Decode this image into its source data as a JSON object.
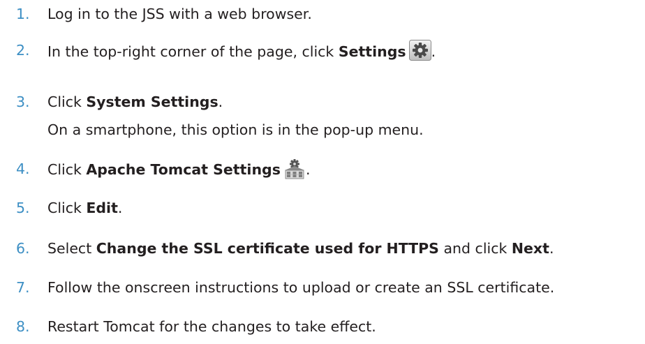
{
  "steps": [
    {
      "number": "1.",
      "text": "Log in to the JSS with a web browser."
    },
    {
      "number": "2.",
      "pre": "In the top-right corner of the page, click ",
      "bold": "Settings",
      "post": "."
    },
    {
      "number": "3.",
      "pre": "Click ",
      "bold": "System Settings",
      "post": ".",
      "note": "On a smartphone, this option is in the pop-up menu."
    },
    {
      "number": "4.",
      "pre": "Click ",
      "bold": "Apache Tomcat Settings",
      "post": "."
    },
    {
      "number": "5.",
      "pre": "Click ",
      "bold": "Edit",
      "post": "."
    },
    {
      "number": "6.",
      "pre": "Select ",
      "bold": "Change the SSL certificate used for HTTPS",
      "mid": " and click ",
      "bold2": "Next",
      "post": "."
    },
    {
      "number": "7.",
      "text": "Follow the onscreen instructions to upload or create an SSL certificate."
    },
    {
      "number": "8.",
      "text": "Restart Tomcat for the changes to take effect."
    }
  ],
  "icons": {
    "settings": "gear-icon",
    "tomcat": "server-building-icon"
  }
}
